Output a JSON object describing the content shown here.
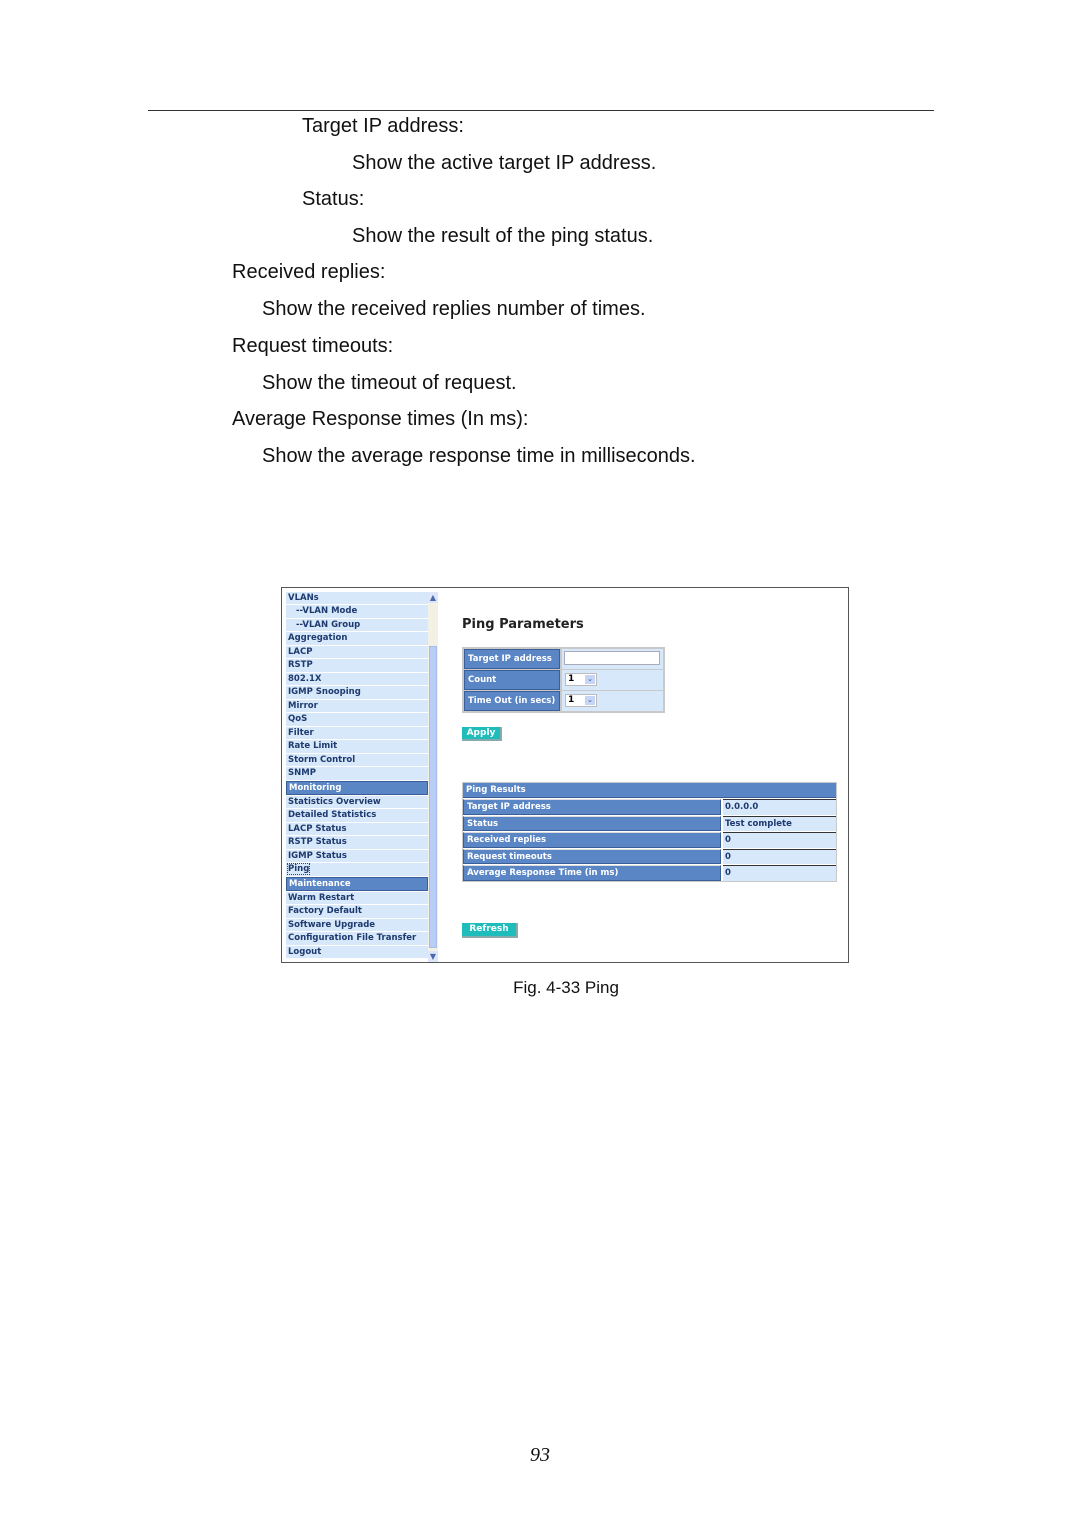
{
  "document": {
    "paragraphs": [
      {
        "text": "Target IP address:",
        "level": 2
      },
      {
        "text": "Show the active target IP address.",
        "level": 3
      },
      {
        "text": "Status:",
        "level": 2
      },
      {
        "text": "Show the result of the ping status.",
        "level": 3
      },
      {
        "text": "Received replies:",
        "level": 0
      },
      {
        "text": "Show the received replies number of times.",
        "level": 1
      },
      {
        "text": "Request timeouts:",
        "level": 0
      },
      {
        "text": "Show the timeout of request.",
        "level": 1
      },
      {
        "text": "Average Response times (In ms):",
        "level": 0
      },
      {
        "text": "Show the average response time in milliseconds.",
        "level": 1
      }
    ],
    "caption": "Fig. 4-33 Ping",
    "page_number": "93"
  },
  "screenshot": {
    "menu": [
      {
        "label": "VLANs",
        "type": "item"
      },
      {
        "label": "--VLAN Mode",
        "type": "sub"
      },
      {
        "label": "--VLAN Group",
        "type": "sub"
      },
      {
        "label": "Aggregation",
        "type": "item"
      },
      {
        "label": "LACP",
        "type": "item"
      },
      {
        "label": "RSTP",
        "type": "item"
      },
      {
        "label": "802.1X",
        "type": "item"
      },
      {
        "label": "IGMP Snooping",
        "type": "item"
      },
      {
        "label": "Mirror",
        "type": "item"
      },
      {
        "label": "QoS",
        "type": "item"
      },
      {
        "label": "Filter",
        "type": "item"
      },
      {
        "label": "Rate Limit",
        "type": "item"
      },
      {
        "label": "Storm Control",
        "type": "item"
      },
      {
        "label": "SNMP",
        "type": "item"
      },
      {
        "label": "Monitoring",
        "type": "section"
      },
      {
        "label": "Statistics Overview",
        "type": "item"
      },
      {
        "label": "Detailed Statistics",
        "type": "item"
      },
      {
        "label": "LACP Status",
        "type": "item"
      },
      {
        "label": "RSTP Status",
        "type": "item"
      },
      {
        "label": "IGMP Status",
        "type": "item"
      },
      {
        "label": "Ping",
        "type": "selected"
      },
      {
        "label": "Maintenance",
        "type": "section"
      },
      {
        "label": "Warm Restart",
        "type": "item"
      },
      {
        "label": "Factory Default",
        "type": "item"
      },
      {
        "label": "Software Upgrade",
        "type": "item"
      },
      {
        "label": "Configuration File Transfer",
        "type": "item"
      },
      {
        "label": "Logout",
        "type": "item"
      }
    ],
    "scroll_up_icon": "▲",
    "scroll_down_icon": "▼",
    "ping_parameters": {
      "title": "Ping Parameters",
      "target_ip_label": "Target IP address",
      "target_ip_value": "",
      "count_label": "Count",
      "count_value": "1",
      "timeout_label": "Time Out (in secs)",
      "timeout_value": "1",
      "dropdown_icon": "⌄",
      "apply_label": "Apply"
    },
    "ping_results": {
      "title": "Ping Results",
      "rows": [
        {
          "label": "Target IP address",
          "value": "0.0.0.0"
        },
        {
          "label": "Status",
          "value": "Test complete"
        },
        {
          "label": "Received replies",
          "value": "0"
        },
        {
          "label": "Request timeouts",
          "value": "0"
        },
        {
          "label": "Average Response Time (in ms)",
          "value": "0"
        }
      ]
    },
    "refresh_label": "Refresh"
  }
}
